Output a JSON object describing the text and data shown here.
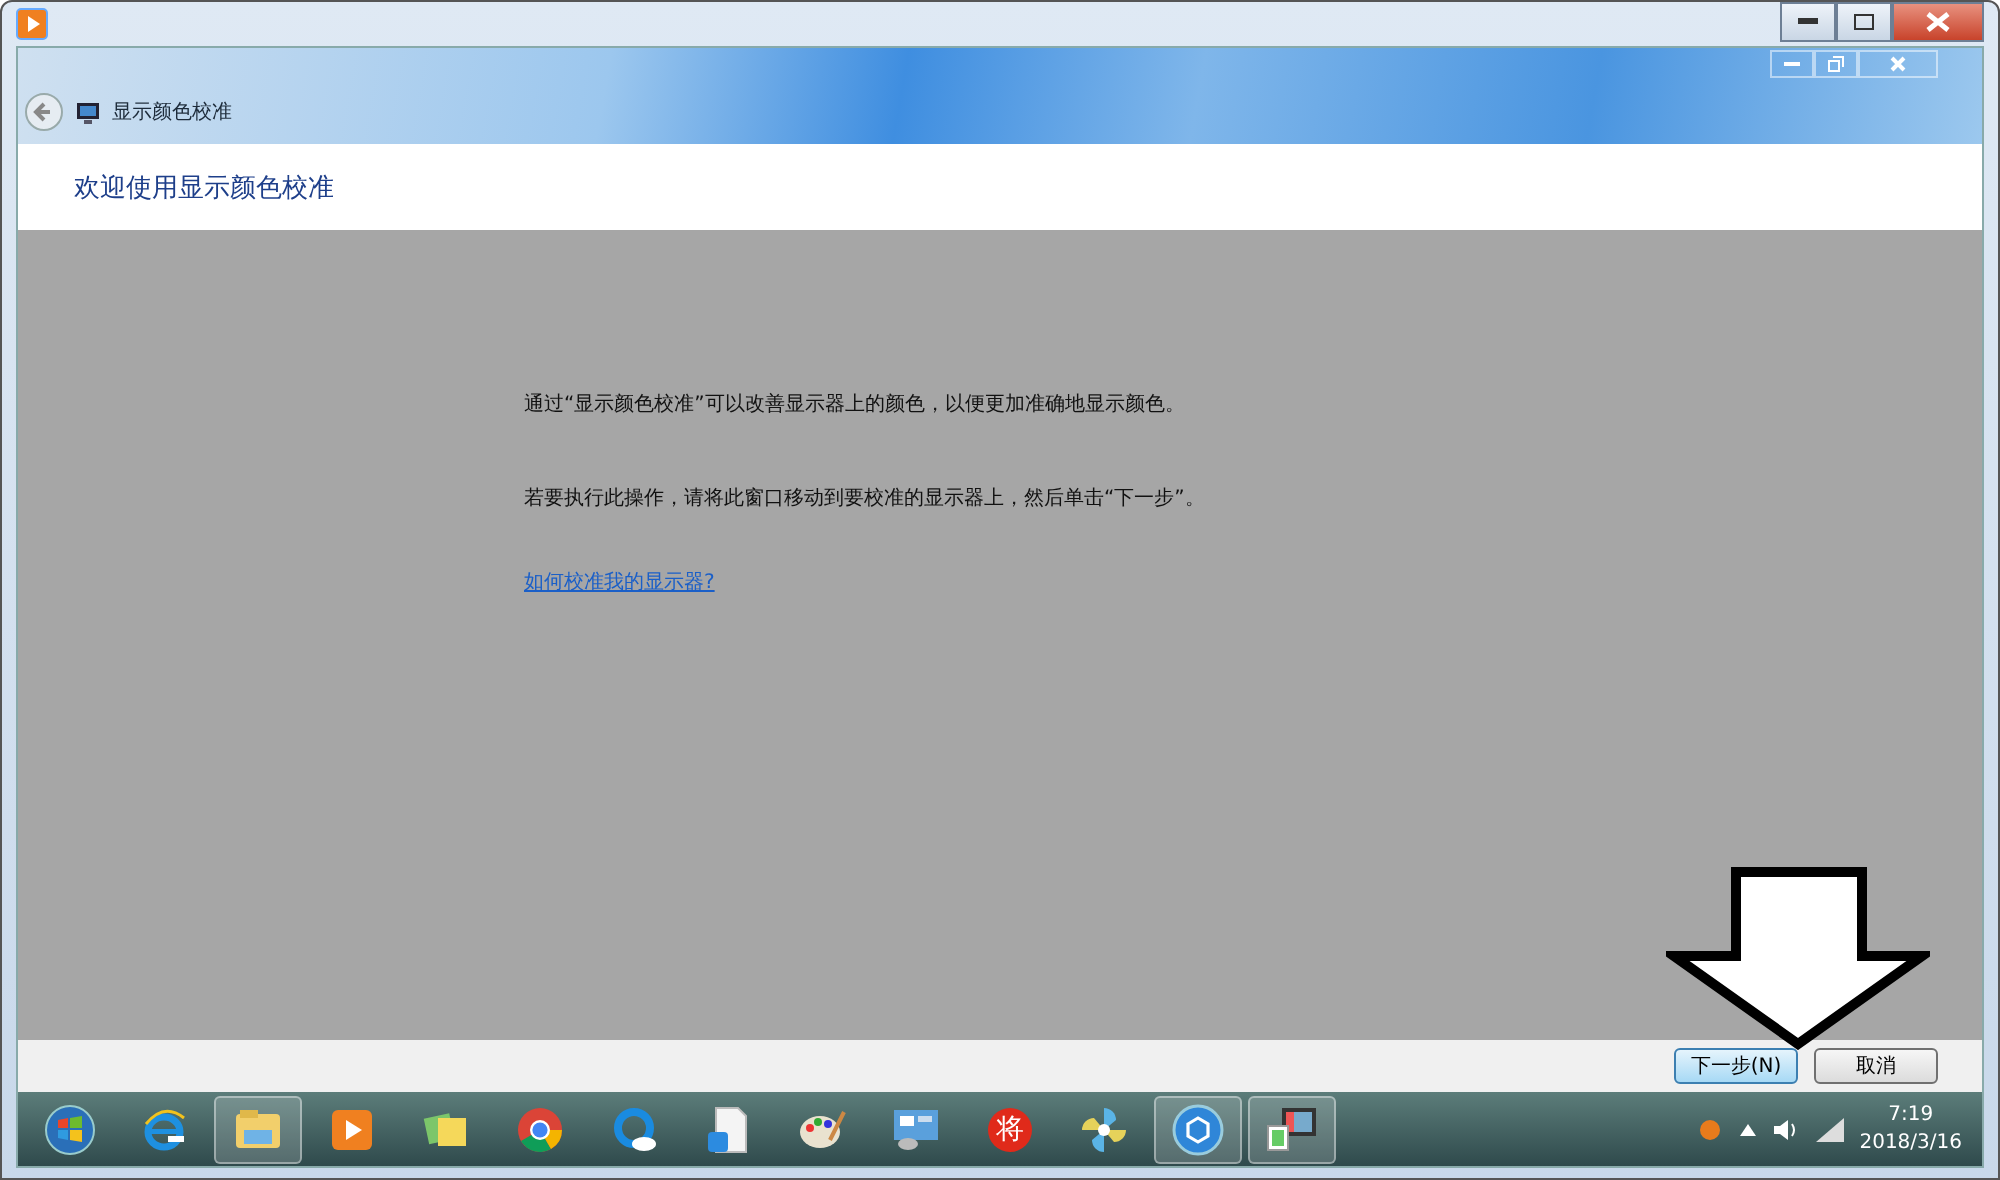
{
  "dialog": {
    "title": "显示颜色校准",
    "heading": "欢迎使用显示颜色校准",
    "paragraphs": [
      "通过“显示颜色校准”可以改善显示器上的颜色，以便更加准确地显示颜色。",
      "若要执行此操作，请将此窗口移动到要校准的显示器上，然后单击“下一步”。"
    ],
    "link": "如何校准我的显示器?",
    "buttons": [
      {
        "label": "下一步(N)",
        "kind": "primary"
      },
      {
        "label": "取消",
        "kind": "normal"
      }
    ]
  },
  "taskbar": {
    "items": [
      {
        "kind": "start",
        "active": false
      },
      {
        "kind": "ie",
        "active": false
      },
      {
        "kind": "folder",
        "active": true
      },
      {
        "kind": "player",
        "active": false
      },
      {
        "kind": "notes",
        "active": false
      },
      {
        "kind": "chrome",
        "active": false
      },
      {
        "kind": "cloud",
        "active": false
      },
      {
        "kind": "document",
        "active": false
      },
      {
        "kind": "paint",
        "active": false
      },
      {
        "kind": "panel",
        "active": false
      },
      {
        "kind": "glyph",
        "label": "将",
        "active": false
      },
      {
        "kind": "pinwheel",
        "active": false
      },
      {
        "kind": "cube",
        "active": true
      },
      {
        "kind": "display",
        "active": true
      }
    ],
    "clock": {
      "time": "7:19",
      "date": "2018/3/16"
    }
  }
}
